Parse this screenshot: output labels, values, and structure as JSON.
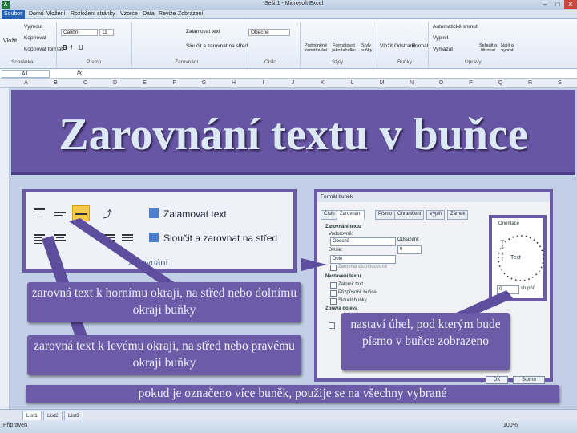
{
  "window": {
    "title": "Sešit1 - Microsoft Excel",
    "app_icon": "X"
  },
  "ribbon_tabs": [
    "Soubor",
    "Domů",
    "Vložení",
    "Rozložení stránky",
    "Vzorce",
    "Data",
    "Revize",
    "Zobrazení"
  ],
  "ribbon": {
    "clipboard": {
      "paste": "Vložit",
      "cut": "Vyjmout",
      "copy": "Kopírovat",
      "format_painter": "Kopírovat formát",
      "group": "Schránka"
    },
    "font": {
      "name": "Calibri",
      "size": "11",
      "group": "Písmo"
    },
    "alignment": {
      "wrap": "Zalamovat text",
      "merge": "Sloučit a zarovnat na střed",
      "group": "Zarovnání"
    },
    "number": {
      "format": "Obecné",
      "group": "Číslo"
    },
    "styles": {
      "cond": "Podmíněné formátování",
      "table": "Formátovat jako tabulku",
      "cell": "Styly buňky",
      "group": "Styly"
    },
    "cells": {
      "insert": "Vložit",
      "delete": "Odstranit",
      "format": "Formát",
      "group": "Buňky"
    },
    "editing": {
      "autosum": "Automatické shrnutí",
      "fill": "Vyplnit",
      "clear": "Vymazat",
      "sort": "Seřadit a filtrovat",
      "find": "Najít a vybrat",
      "group": "Úpravy"
    }
  },
  "formula_bar": {
    "name_box": "A1",
    "fx": "fx"
  },
  "columns": [
    "A",
    "B",
    "C",
    "D",
    "E",
    "F",
    "G",
    "H",
    "I",
    "J",
    "K",
    "L",
    "M",
    "N",
    "O",
    "P",
    "Q",
    "R",
    "S"
  ],
  "slide": {
    "title": "Zarovnání textu v buňce",
    "panel": {
      "wrap_label": "Zalamovat text",
      "merge_label": "Sloučit a zarovnat na střed",
      "group_label": "Zarovnání"
    },
    "dialog": {
      "title": "Formát buněk",
      "tabs": [
        "Číslo",
        "Zarovnání",
        "Písmo",
        "Ohraničení",
        "Výplň",
        "Zámek"
      ],
      "section_alignment": "Zarovnání textu",
      "horizontal_label": "Vodorovně:",
      "horizontal_value": "Obecně",
      "indent_label": "Odsazení:",
      "indent_value": "0",
      "vertical_label": "Svisle:",
      "vertical_value": "Dole",
      "justify_distributed": "Zarovnat distribuovaně",
      "section_control": "Nastavení textu",
      "wrap_check": "Zalomit text",
      "shrink_check": "Přizpůsobit buňce",
      "merge_check": "Sloučit buňky",
      "section_rtl": "Zprava doleva",
      "orientation_label": "Orientace",
      "orientation_text": "Text",
      "degrees_value": "0",
      "degrees_label": "stupňů",
      "ok": "OK",
      "cancel": "Storno"
    },
    "callouts": {
      "vertical": "zarovná text k hornímu okraji, na střed nebo dolnímu okraji buňky",
      "horizontal": "zarovná text k levému okraji, na střed nebo pravému okraji buňky",
      "angle": "nastaví úhel, pod kterým bude písmo v buňce zobrazeno",
      "merge": "pokud je označeno více buněk, použije se na všechny vybrané"
    }
  },
  "sheet_tabs": [
    "List1",
    "List2",
    "List3"
  ],
  "status": {
    "left": "Připraven",
    "zoom": "100%"
  },
  "colors": {
    "banner": "#6756a3",
    "callout": "#6c5ca8",
    "title_text": "#dde8f5",
    "border": "#6a5aa8"
  }
}
